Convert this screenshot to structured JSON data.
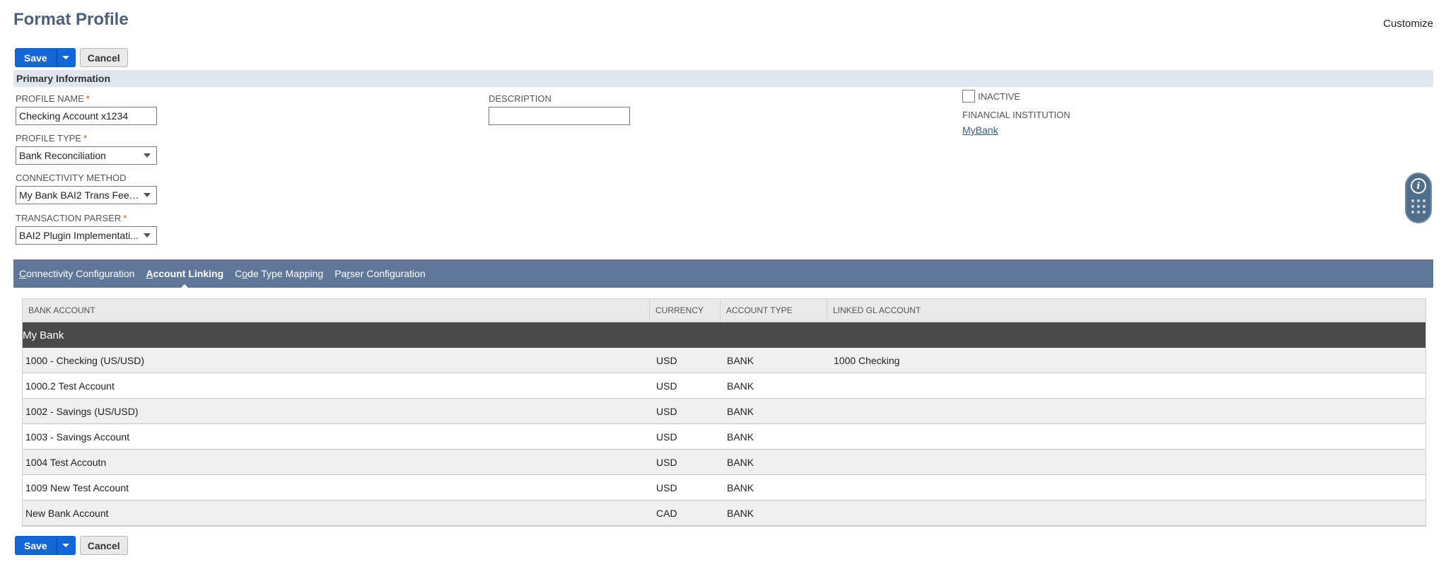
{
  "header": {
    "title": "Format Profile",
    "customize_label": "Customize"
  },
  "actions": {
    "save_label": "Save",
    "cancel_label": "Cancel"
  },
  "section": {
    "title": "Primary Information"
  },
  "fields": {
    "profile_name": {
      "label": "PROFILE NAME",
      "value": "Checking Account x1234",
      "required": "*"
    },
    "description": {
      "label": "DESCRIPTION",
      "value": ""
    },
    "inactive": {
      "label": "INACTIVE",
      "checked": false
    },
    "financial_institution": {
      "label": "FINANCIAL INSTITUTION",
      "value": "MyBank"
    },
    "profile_type": {
      "label": "PROFILE TYPE",
      "value": "Bank Reconciliation",
      "required": "*"
    },
    "connectivity_method": {
      "label": "CONNECTIVITY METHOD",
      "value": "My Bank BAI2 Trans Feed ..."
    },
    "transaction_parser": {
      "label": "TRANSACTION PARSER",
      "value": "BAI2 Plugin Implementati...",
      "required": "*"
    }
  },
  "tabs": [
    {
      "pre": "",
      "ul": "C",
      "post": "onnectivity Configuration",
      "active": false
    },
    {
      "pre": "",
      "ul": "A",
      "post": "ccount Linking",
      "active": true
    },
    {
      "pre": "C",
      "ul": "o",
      "post": "de Type Mapping",
      "active": false
    },
    {
      "pre": "Pa",
      "ul": "r",
      "post": "ser Configuration",
      "active": false
    }
  ],
  "table": {
    "columns": [
      "BANK ACCOUNT",
      "CURRENCY",
      "ACCOUNT TYPE",
      "LINKED GL ACCOUNT"
    ],
    "group": "My Bank",
    "rows": [
      {
        "bank_account": "1000 - Checking (US/USD)",
        "currency": "USD",
        "account_type": "BANK",
        "linked_gl": "1000 Checking"
      },
      {
        "bank_account": "1000.2 Test Account",
        "currency": "USD",
        "account_type": "BANK",
        "linked_gl": ""
      },
      {
        "bank_account": "1002 - Savings (US/USD)",
        "currency": "USD",
        "account_type": "BANK",
        "linked_gl": ""
      },
      {
        "bank_account": "1003 - Savings Account",
        "currency": "USD",
        "account_type": "BANK",
        "linked_gl": ""
      },
      {
        "bank_account": "1004 Test Accoutn",
        "currency": "USD",
        "account_type": "BANK",
        "linked_gl": ""
      },
      {
        "bank_account": "1009 New Test Account",
        "currency": "USD",
        "account_type": "BANK",
        "linked_gl": ""
      },
      {
        "bank_account": "New Bank Account",
        "currency": "CAD",
        "account_type": "BANK",
        "linked_gl": ""
      }
    ]
  },
  "icons": {
    "dropdown": "caret-down-icon",
    "info": "info-icon",
    "apps": "dots-grid-icon"
  },
  "colors": {
    "primary": "#1467d8",
    "title": "#4d5f79",
    "tab_bar": "#607799",
    "section_bar": "#e0e6ef",
    "group_row": "#4a4a4a"
  }
}
